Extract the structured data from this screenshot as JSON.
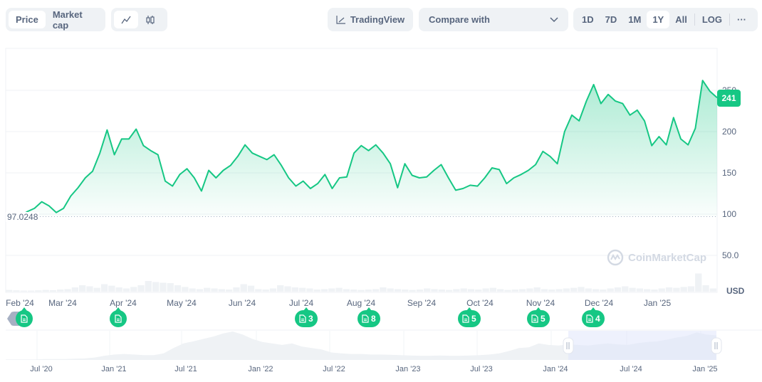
{
  "toolbar": {
    "type_tabs": [
      {
        "label": "Price",
        "active": true
      },
      {
        "label": "Market cap",
        "active": false
      }
    ],
    "style_tabs": [
      {
        "icon": "line-chart-icon",
        "active": true
      },
      {
        "icon": "candlestick-icon",
        "active": false
      }
    ],
    "tradingview_label": "TradingView",
    "compare_label": "Compare with",
    "range_tabs": [
      {
        "label": "1D",
        "active": false
      },
      {
        "label": "7D",
        "active": false
      },
      {
        "label": "1M",
        "active": false
      },
      {
        "label": "1Y",
        "active": true
      },
      {
        "label": "All",
        "active": false
      }
    ],
    "log_label": "LOG",
    "more_label": "···"
  },
  "chart": {
    "current_price_label": "241",
    "start_price_label": "97.0248",
    "currency_label": "USD",
    "watermark": "CoinMarketCap",
    "accent_color": "#16c784",
    "news_markers": [
      {
        "month": "Feb '24",
        "count": ""
      },
      {
        "month": "Apr '24",
        "count": ""
      },
      {
        "month": "Jul '24",
        "count": "3"
      },
      {
        "month": "Aug '24",
        "count": "8"
      },
      {
        "month": "Oct '24",
        "count": "5"
      },
      {
        "month": "Nov '24",
        "count": "5"
      },
      {
        "month": "Dec '24",
        "count": "4"
      }
    ]
  },
  "chart_data": {
    "type": "area",
    "title": "",
    "xlabel": "",
    "ylabel": "USD",
    "ylim": [
      0,
      265
    ],
    "y_ticks": [
      "50.0",
      "100",
      "150",
      "200",
      "250"
    ],
    "y_tick_values": [
      50,
      100,
      150,
      200,
      250
    ],
    "x_tick_labels": [
      "Feb '24",
      "Mar '24",
      "Apr '24",
      "May '24",
      "Jun '24",
      "Jul '24",
      "Aug '24",
      "Sep '24",
      "Oct '24",
      "Nov '24",
      "Dec '24",
      "Jan '25"
    ],
    "grid": true,
    "reference_line": 97.0248,
    "current_value": 241,
    "x": [
      0,
      1,
      2,
      3,
      4,
      5,
      6,
      7,
      8,
      9,
      10,
      11,
      12,
      13,
      14,
      15,
      16,
      17,
      18,
      19,
      20,
      21,
      22,
      23,
      24,
      25,
      26,
      27,
      28,
      29,
      30,
      31,
      32,
      33,
      34,
      35,
      36,
      37,
      38,
      39,
      40,
      41,
      42,
      43,
      44,
      45,
      46,
      47,
      48,
      49,
      50,
      51,
      52,
      53,
      54,
      55,
      56,
      57,
      58,
      59,
      60,
      61,
      62,
      63,
      64,
      65,
      66,
      67,
      68,
      69,
      70,
      71,
      72,
      73,
      74,
      75,
      76,
      77,
      78,
      79,
      80,
      81,
      82,
      83,
      84,
      85,
      86,
      87,
      88,
      89,
      90,
      91,
      92,
      93,
      94,
      95,
      96
    ],
    "series": [
      {
        "name": "Price",
        "values": [
          97,
          103,
          107,
          115,
          110,
          102,
          107,
          122,
          132,
          144,
          152,
          174,
          202,
          172,
          191,
          191,
          203,
          183,
          177,
          172,
          140,
          134,
          148,
          155,
          144,
          128,
          153,
          144,
          153,
          159,
          170,
          184,
          174,
          170,
          166,
          172,
          159,
          144,
          134,
          140,
          131,
          137,
          148,
          131,
          144,
          145,
          174,
          183,
          177,
          184,
          174,
          161,
          132,
          161,
          147,
          144,
          145,
          153,
          160,
          144,
          129,
          131,
          135,
          134,
          144,
          156,
          154,
          137,
          144,
          148,
          153,
          160,
          176,
          170,
          161,
          200,
          220,
          213,
          237,
          257,
          234,
          245,
          237,
          234,
          220,
          226,
          213,
          183,
          194,
          184,
          217,
          191,
          184,
          204,
          262,
          249,
          241
        ]
      }
    ],
    "volume_relative": [
      0.08,
      0.06,
      0.05,
      0.05,
      0.06,
      0.08,
      0.07,
      0.1,
      0.12,
      0.2,
      0.3,
      0.25,
      0.18,
      0.35,
      0.28,
      0.2,
      0.15,
      0.22,
      0.3,
      0.5,
      0.45,
      0.42,
      0.4,
      0.3,
      0.22,
      0.15,
      0.12,
      0.18,
      0.15,
      0.12,
      0.1,
      0.2,
      0.35,
      0.28,
      0.12,
      0.1,
      0.15,
      0.3,
      0.25,
      0.2,
      0.18,
      0.15,
      0.1,
      0.12,
      0.15,
      0.18,
      0.12,
      0.1,
      0.08,
      0.1,
      0.12,
      0.2,
      0.15,
      0.12,
      0.1,
      0.08,
      0.1,
      0.15,
      0.12,
      0.1,
      0.08,
      0.12,
      0.15,
      0.12,
      0.1,
      0.15,
      0.18,
      0.12,
      0.08,
      0.1,
      0.12,
      0.15,
      0.2,
      0.12,
      0.1,
      0.12,
      0.15,
      0.18,
      0.22,
      0.15,
      0.12,
      0.1,
      0.15,
      0.2,
      0.25,
      0.18,
      0.15,
      0.12,
      0.1,
      0.15,
      0.2,
      0.18,
      0.22,
      0.25,
      0.85,
      0.3,
      0.15
    ]
  },
  "overview": {
    "x_tick_labels": [
      "Jul '20",
      "Jan '21",
      "Jul '21",
      "Jan '22",
      "Jul '22",
      "Jan '23",
      "Jul '23",
      "Jan '24",
      "Jul '24",
      "Jan '25"
    ],
    "values": [
      2,
      2,
      2,
      2,
      3,
      3,
      3,
      4,
      5,
      8,
      14,
      18,
      20,
      18,
      16,
      16,
      22,
      40,
      55,
      62,
      70,
      78,
      88,
      95,
      85,
      70,
      60,
      55,
      50,
      55,
      45,
      40,
      35,
      25,
      22,
      20,
      20,
      18,
      18,
      17,
      16,
      15,
      14,
      14,
      15,
      14,
      14,
      15,
      16,
      18,
      22,
      30,
      40,
      42,
      55,
      50,
      48,
      52,
      50,
      48,
      52,
      55,
      52,
      50,
      56,
      60,
      62,
      68,
      75,
      80,
      92,
      85,
      82
    ]
  }
}
